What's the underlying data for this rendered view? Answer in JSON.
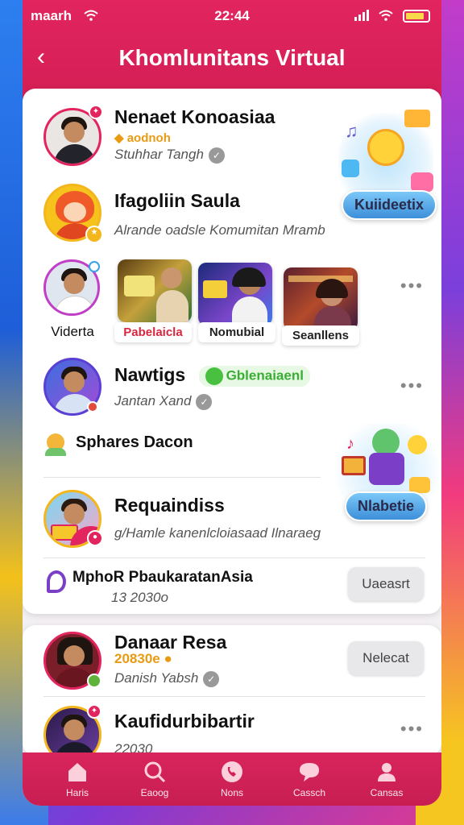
{
  "status": {
    "carrier": "maarh",
    "time": "22:44"
  },
  "header": {
    "title": "Khomlunitans Virtual"
  },
  "colors": {
    "primary": "#e2245f",
    "gold": "#f3b61c",
    "green": "#49c040"
  },
  "rows": [
    {
      "name": "Nenaet Konoasiaa",
      "tag": "aodnoh",
      "sub": "Stuhhar Tangh"
    },
    {
      "name": "Ifagoliin Saula",
      "sub": "Alrande oadsle Komumitan Mramb"
    },
    {
      "name": "Nawtigs",
      "pill": "Gblenaiaenl",
      "sub": "Jantan Xand"
    },
    {
      "name": "Requaindiss",
      "sub": "g/Hamle kanenlcloiasaad Ilnaraeg"
    },
    {
      "name": "Danaar Resa",
      "tag": "20830e",
      "sub": "Danish Yabsh"
    },
    {
      "name": "Kaufidurbibartir",
      "sub": "22030"
    }
  ],
  "stories": {
    "first_label": "Viderta",
    "items": [
      "Pabelaicla",
      "Nomubial",
      "Seanllens"
    ]
  },
  "sphares": {
    "label": "Sphares Dacon"
  },
  "app_row": {
    "title": "MphoR PbaukaratanAsia",
    "count": "13 2030o",
    "button": "Uaeasrt"
  },
  "second_button": "Nelecat",
  "stickers": {
    "top": "Kuiideetix",
    "middle": "Nlabetie"
  },
  "tabs": [
    "Haris",
    "Eaoog",
    "Nons",
    "Cassch",
    "Cansas"
  ]
}
